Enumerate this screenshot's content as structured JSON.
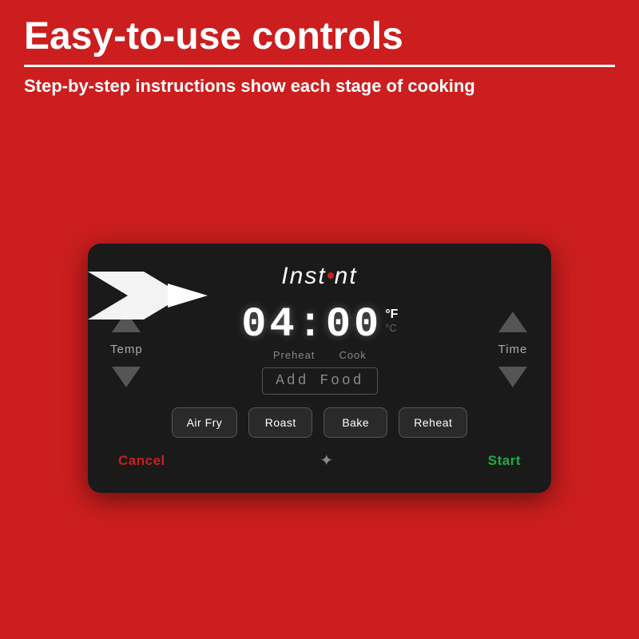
{
  "header": {
    "title": "Easy-to-use controls",
    "subtitle": "Step-by-step instructions show each stage of cooking"
  },
  "brand": "Instant",
  "display": {
    "time": "04:00",
    "fahrenheit": "°F",
    "celsius": "°C",
    "preheat_label": "Preheat",
    "cook_label": "Cook",
    "add_food": "Add Food"
  },
  "controls": {
    "temp_label": "Temp",
    "time_label": "Time"
  },
  "buttons": {
    "air_fry": "Air Fry",
    "roast": "Roast",
    "bake": "Bake",
    "reheat": "Reheat",
    "cancel": "Cancel",
    "start": "Start"
  },
  "colors": {
    "background": "#cc1e1e",
    "panel": "#1a1a1a",
    "cancel": "#cc1e1e",
    "start": "#22aa44"
  }
}
